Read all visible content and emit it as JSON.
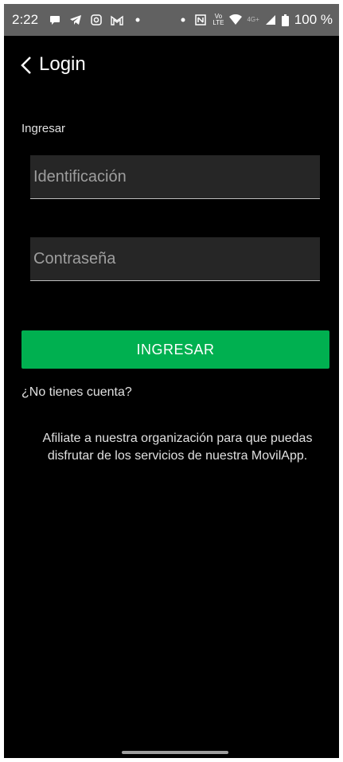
{
  "status_bar": {
    "time": "2:22",
    "battery": "100 %",
    "network": "4G+",
    "volte": "Vo LTE",
    "icons_left": [
      "chat-icon",
      "telegram-icon",
      "instagram-icon",
      "gmail-icon",
      "dot-icon"
    ],
    "icons_right": [
      "dot-icon",
      "nfc-icon",
      "volte-icon",
      "wifi-icon",
      "signal-icon",
      "battery-icon"
    ]
  },
  "header": {
    "title": "Login",
    "back_icon": "chevron-left-icon"
  },
  "form": {
    "section_label": "Ingresar",
    "identification_placeholder": "Identificación",
    "identification_value": "",
    "password_placeholder": "Contraseña",
    "password_value": "",
    "submit_label": "INGRESAR"
  },
  "footer": {
    "no_account": "¿No tienes cuenta?",
    "info": "Afiliate a nuestra organización para que puedas disfrutar de los servicios de nuestra MovilApp."
  },
  "colors": {
    "background": "#000000",
    "accent": "#00B050",
    "status_bar": "#616161",
    "field_bg": "#262626"
  }
}
